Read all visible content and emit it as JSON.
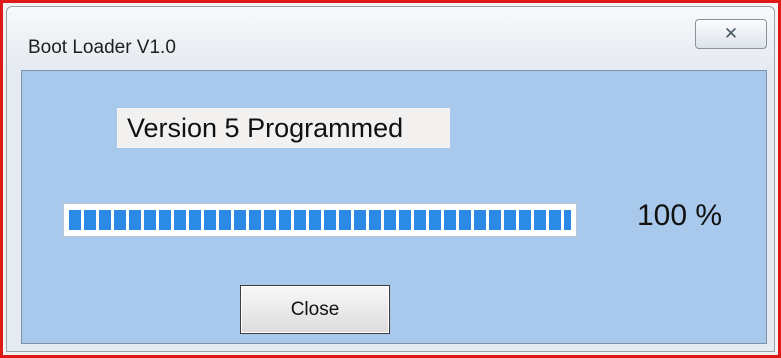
{
  "window": {
    "title": "Boot Loader V1.0",
    "close_glyph": "✕"
  },
  "status": {
    "message": "Version 5 Programmed"
  },
  "progress": {
    "value_percent": 100,
    "label": "100 %",
    "bar_color": "#2b8ae6"
  },
  "buttons": {
    "close_label": "Close"
  },
  "colors": {
    "client_background": "#a9c9ec",
    "frame_highlight": "#e01818"
  }
}
